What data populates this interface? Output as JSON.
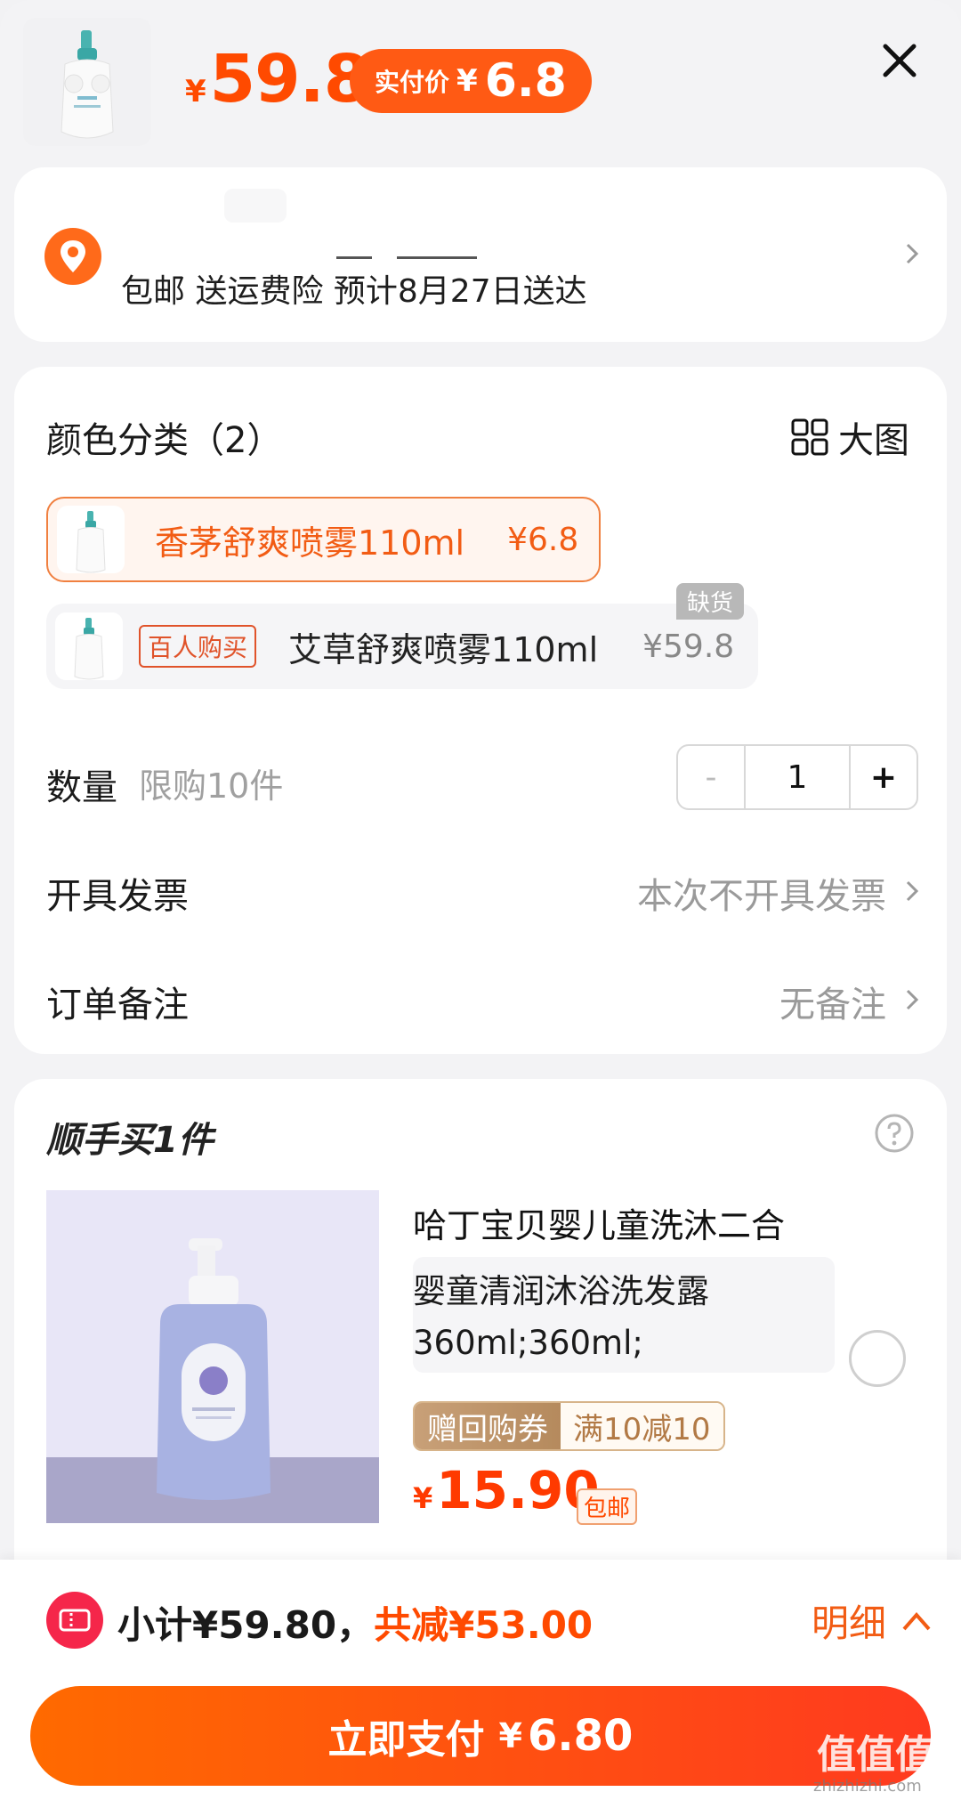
{
  "header": {
    "price_currency": "¥",
    "price_value": "59.8",
    "pay_label": "实付价",
    "pay_currency": "¥",
    "pay_value": "6.8"
  },
  "address": {
    "line": "包邮 送运费险 预计8月27日送达"
  },
  "spec": {
    "color_title": "颜色分类（2）",
    "big_image_label": "大图",
    "options": [
      {
        "name": "香茅舒爽喷雾110ml",
        "price": "¥6.8"
      },
      {
        "tag": "百人购买",
        "name": "艾草舒爽喷雾110ml",
        "price": "¥59.8",
        "stock": "缺货"
      }
    ],
    "quantity_title": "数量",
    "quantity_hint": "限购10件",
    "quantity_minus": "-",
    "quantity_value": "1",
    "quantity_plus": "+",
    "invoice_title": "开具发票",
    "invoice_value": "本次不开具发票",
    "note_title": "订单备注",
    "note_value": "无备注"
  },
  "addon": {
    "title": "顺手买1件",
    "product_name": "哈丁宝贝婴儿童洗沐二合",
    "spec_line1": "婴童清润沐浴洗发露",
    "spec_line2": "360ml;360ml;",
    "coupon_left": "赠回购券",
    "coupon_right": "满10减10",
    "price_currency": "¥",
    "price_value": "15.90",
    "ship_tag": "包邮"
  },
  "footer": {
    "subtotal": "小计¥59.80，",
    "saved": "共减¥53.00",
    "detail_label": "明细",
    "pay_label": "立即支付",
    "pay_currency": "¥",
    "pay_value": "6.80"
  },
  "watermark": {
    "main": "值值值",
    "sub": "zhizhizhi.com"
  },
  "colors": {
    "accent": "#ff4a00",
    "pay_gradient_start": "#ff6a00",
    "pay_gradient_end": "#ff3a1f"
  }
}
